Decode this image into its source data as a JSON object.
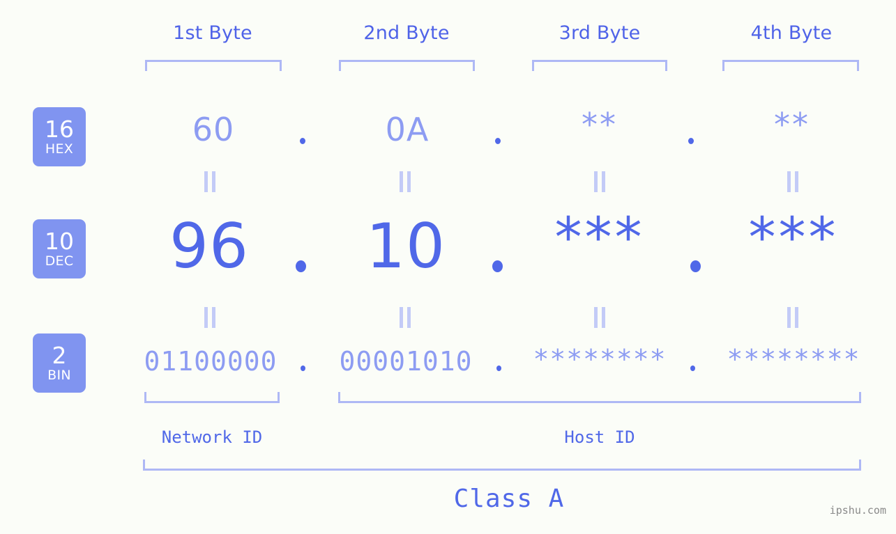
{
  "background_color": "#fbfdf8",
  "accent_colors": {
    "strong_blue": "#5068e8",
    "light_blue": "#8d9cf2",
    "badge_blue": "#8094f0",
    "bracket_blue": "#aeb8f5",
    "equals_blue": "#c3cbf7",
    "watermark_gray": "#8a8a8a"
  },
  "byte_headers": [
    {
      "label": "1st Byte"
    },
    {
      "label": "2nd Byte"
    },
    {
      "label": "3rd Byte"
    },
    {
      "label": "4th Byte"
    }
  ],
  "rows": {
    "hex": {
      "badge_number": "16",
      "badge_name": "HEX",
      "values": [
        "60",
        "0A",
        "**",
        "**"
      ],
      "separators": [
        ".",
        ".",
        "."
      ]
    },
    "dec": {
      "badge_number": "10",
      "badge_name": "DEC",
      "values": [
        "96",
        "10",
        "***",
        "***"
      ],
      "separators": [
        ".",
        ".",
        "."
      ]
    },
    "bin": {
      "badge_number": "2",
      "badge_name": "BIN",
      "values": [
        "01100000",
        "00001010",
        "********",
        "********"
      ],
      "separators": [
        ".",
        ".",
        "."
      ]
    }
  },
  "equals_marks": {
    "glyph": "||",
    "count_per_gap": 4,
    "gaps": 2
  },
  "segments": {
    "network_id": "Network ID",
    "host_id": "Host ID"
  },
  "class_label": "Class A",
  "watermark": "ipshu.com"
}
